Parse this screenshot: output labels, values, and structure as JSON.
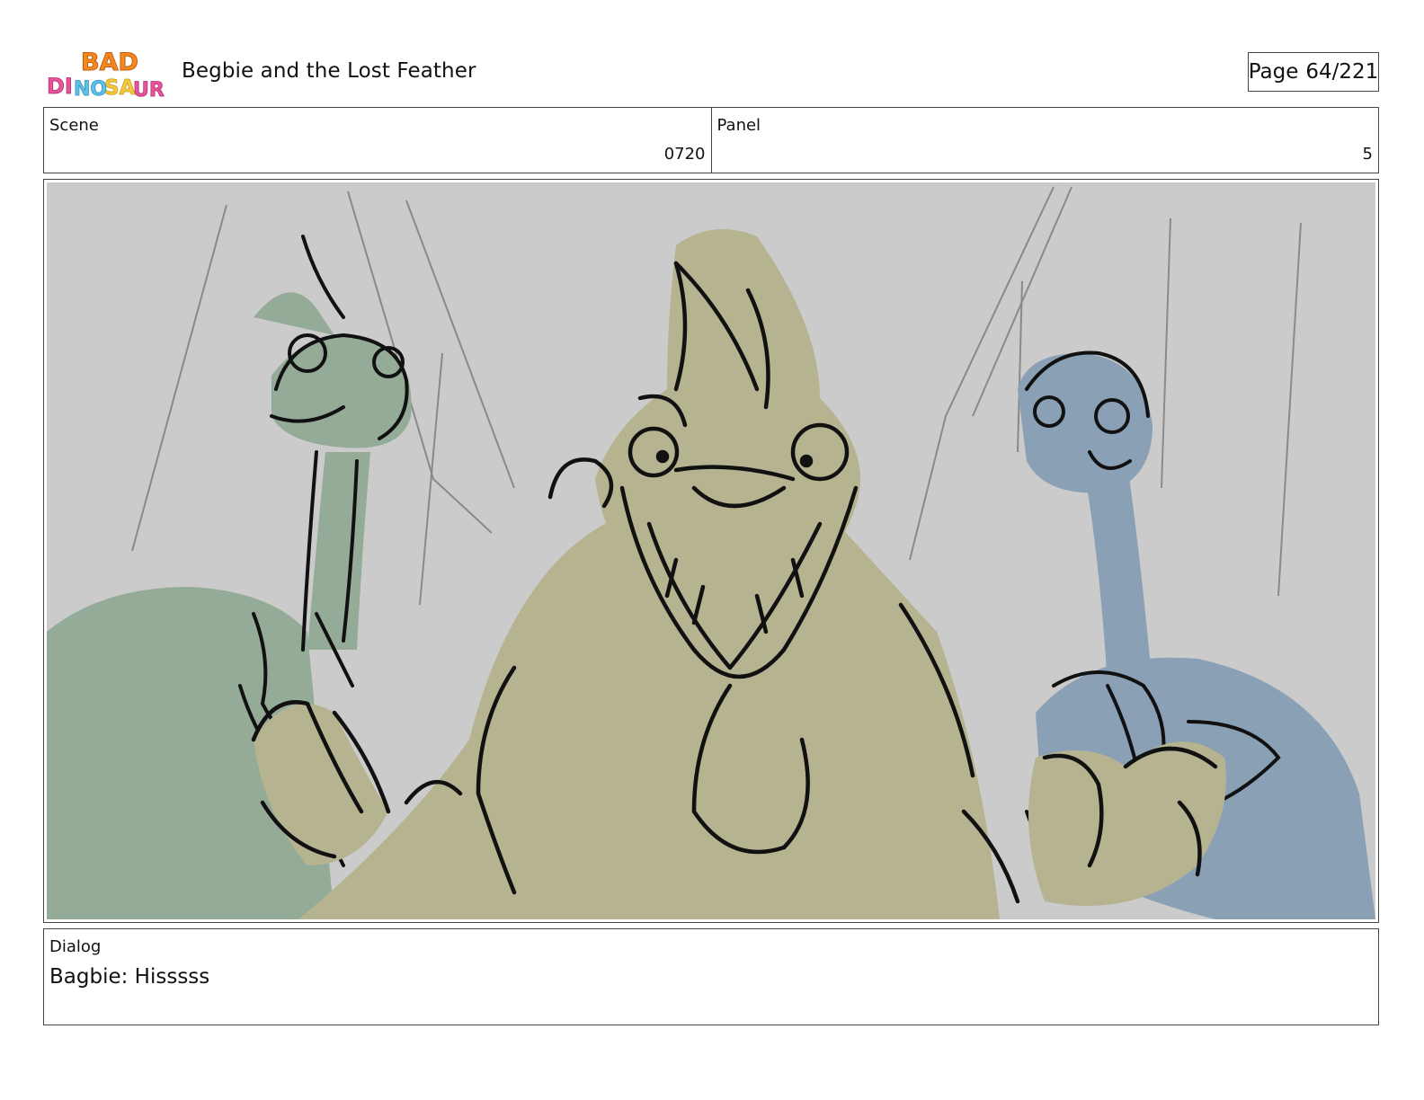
{
  "header": {
    "logo_text": "BAD DINOSAURS",
    "title": "Begbie and the Lost Feather",
    "page_label": "Page",
    "page_value": "64/221"
  },
  "meta": {
    "scene_label": "Scene",
    "scene_value": "0720",
    "panel_label": "Panel",
    "panel_value": "5"
  },
  "dialog": {
    "label": "Dialog",
    "text": "Bagbie: Hisssss"
  },
  "colors": {
    "background_gray": "#cbcbcb",
    "green_dino": "#94ab97",
    "tan_dino": "#b6b391",
    "blue_dino": "#8aa0b5",
    "ink": "#111111"
  }
}
